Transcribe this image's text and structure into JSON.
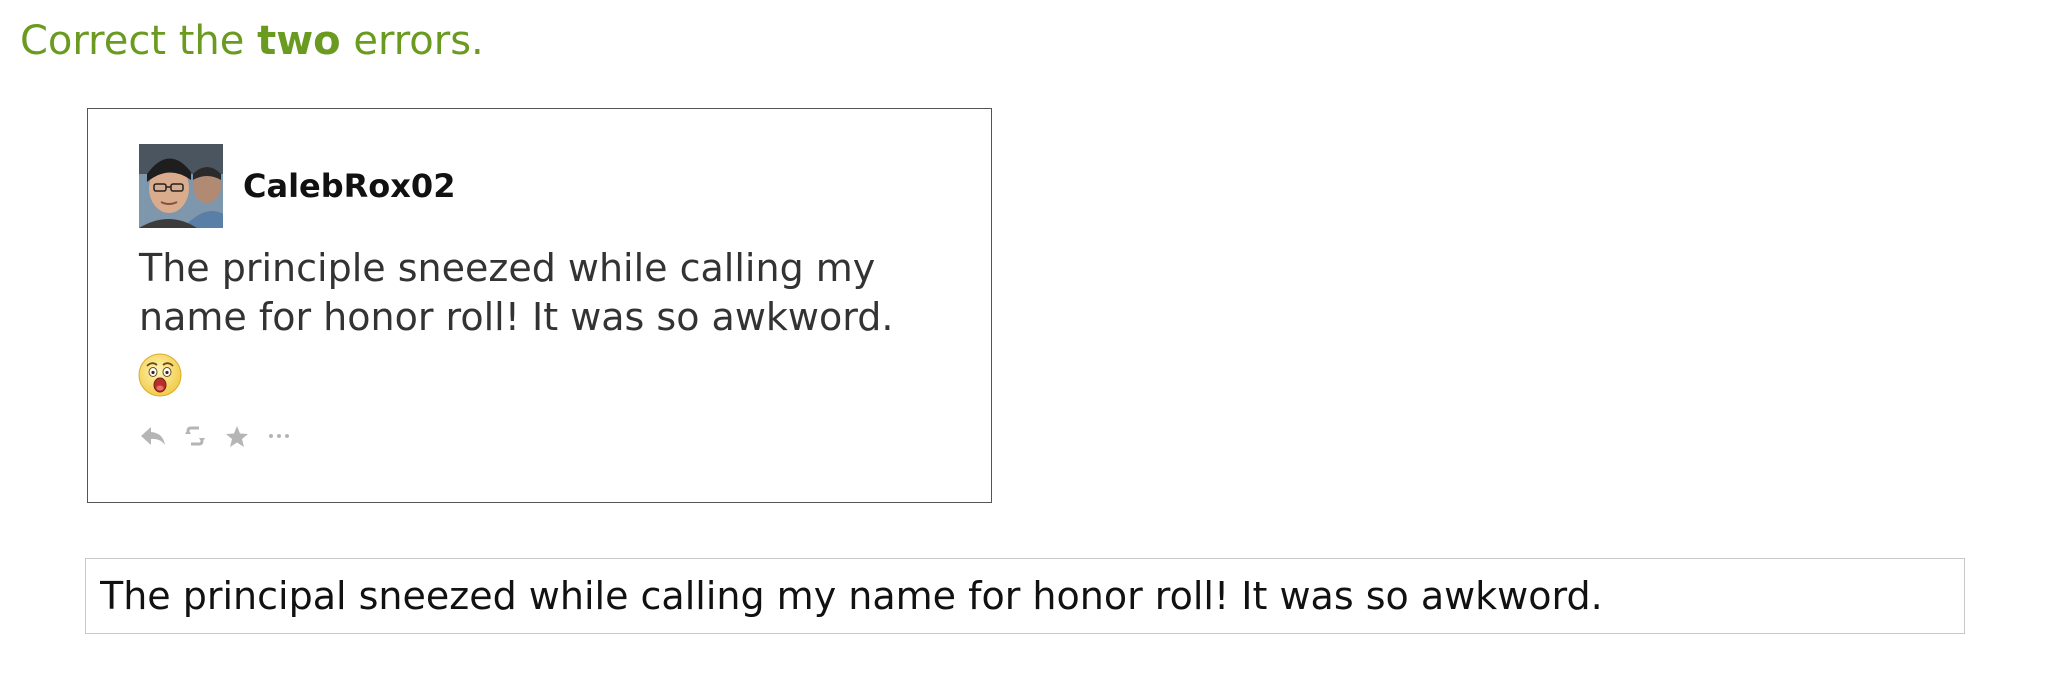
{
  "prompt": {
    "prefix": "Correct the ",
    "emphasis": "two",
    "suffix": " errors."
  },
  "tweet": {
    "username": "CalebRox02",
    "text": "The principle sneezed while calling my name for honor roll! It was so awkword.",
    "emoji": "astonished-face",
    "actions": [
      "reply-icon",
      "retweet-icon",
      "favorite-icon",
      "more-icon"
    ]
  },
  "answer": {
    "value": "The principal sneezed while calling my name for honor roll! It was so awkword."
  },
  "colors": {
    "prompt": "#6a9a1f",
    "action_icons": "#b5b5b5"
  }
}
